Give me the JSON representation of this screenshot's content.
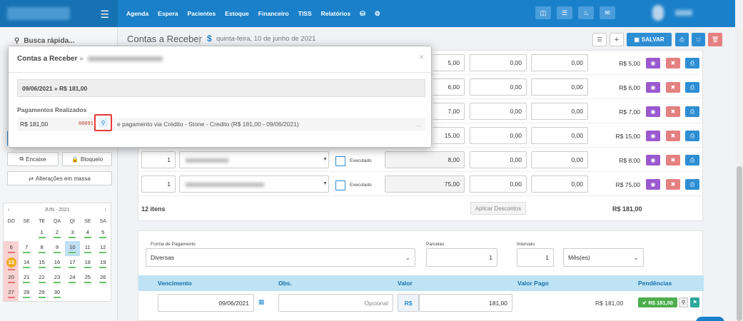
{
  "nav": {
    "items": [
      "Agenda",
      "Espera",
      "Pacientes",
      "Estoque",
      "Financeiro",
      "TISS",
      "Relatórios"
    ]
  },
  "sidebar": {
    "quick_search": "Busca rápida...",
    "encaixe": "Encaixe",
    "bloqueio": "Bloqueio",
    "alteracoes": "Alterações em massa",
    "calendar": {
      "month": "JUN - 2021",
      "dow": [
        "DO",
        "SE",
        "TE",
        "QA",
        "QI",
        "SE",
        "SA"
      ],
      "weeks": [
        [
          "",
          "",
          "1",
          "2",
          "3",
          "4",
          "5"
        ],
        [
          "6",
          "7",
          "8",
          "9",
          "10",
          "11",
          "12"
        ],
        [
          "13",
          "14",
          "15",
          "16",
          "17",
          "18",
          "19"
        ],
        [
          "20",
          "21",
          "22",
          "23",
          "24",
          "25",
          "26"
        ],
        [
          "27",
          "28",
          "29",
          "30",
          "",
          "",
          ""
        ]
      ]
    }
  },
  "header": {
    "title": "Contas a Receber",
    "dollar": "$",
    "date": "quinta-feira, 10 de junho de 2021",
    "save": "SALVAR"
  },
  "items": [
    {
      "qty": "",
      "value": "5,00",
      "disc1": "0,00",
      "disc2": "0,00",
      "total": "R$ 5,00"
    },
    {
      "qty": "",
      "value": "6,00",
      "disc1": "0,00",
      "disc2": "0,00",
      "total": "R$ 6,00"
    },
    {
      "qty": "",
      "value": "7,00",
      "disc1": "0,00",
      "disc2": "0,00",
      "total": "R$ 7,00"
    },
    {
      "qty": "",
      "value": "15,00",
      "disc1": "0,00",
      "disc2": "0,00",
      "total": "R$ 15,00"
    },
    {
      "qty": "1",
      "value": "8,00",
      "disc1": "0,00",
      "disc2": "0,00",
      "total": "R$ 8,00",
      "executed": "Executado"
    },
    {
      "qty": "1",
      "value": "75,00",
      "disc1": "0,00",
      "disc2": "0,00",
      "total": "R$ 75,00",
      "executed": "Executado"
    }
  ],
  "summary": {
    "count": "12 itens",
    "apply_discounts": "Aplicar Descontos",
    "total": "R$ 181,00"
  },
  "payment": {
    "method_label": "Forma de Pagamento",
    "method_value": "Diversas",
    "parcelas_label": "Parcelas",
    "parcelas_value": "1",
    "intervalo_label": "Intervalo",
    "intervalo_value": "1",
    "period_value": "Mês(es)",
    "cols": [
      "Vencimento",
      "Obs.",
      "Valor",
      "Valor Pago",
      "Pendências"
    ],
    "row": {
      "due": "09/06/2021",
      "obs_placeholder": "Opcional",
      "currency": "R$",
      "value": "181,00",
      "paid": "R$ 181,00",
      "pending_badge": "R$ 181,00"
    }
  },
  "modal": {
    "title": "Contas a Receber",
    "title_sep": "»",
    "date_line": "09/06/2021 » R$ 181,00",
    "subtitle": "Pagamentos Realizados",
    "pay_amount": "R$ 181,00",
    "pay_code": "00091",
    "pay_desc": "e pagamento via Crédito - Stone - Credito (R$ 181,00 - 09/06/2021)",
    "dots": "...",
    "close": "×"
  }
}
